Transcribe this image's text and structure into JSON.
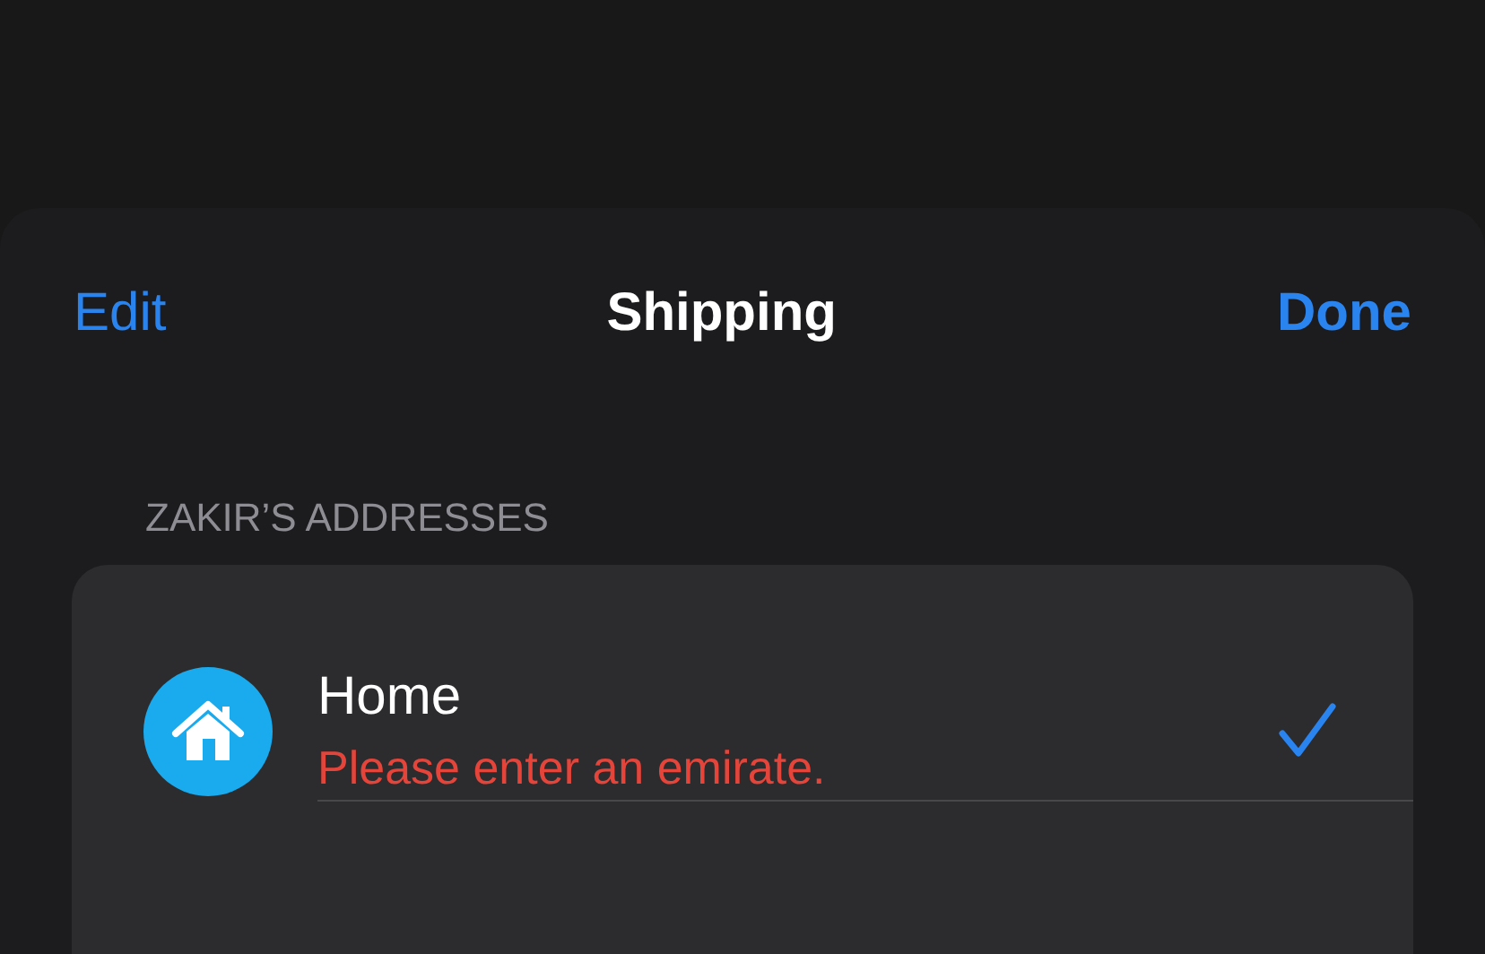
{
  "nav": {
    "left": "Edit",
    "title": "Shipping",
    "right": "Done"
  },
  "section": {
    "header": "ZAKIR’S ADDRESSES",
    "addresses": [
      {
        "label": "Home",
        "error": "Please enter an emirate.",
        "selected": true
      }
    ]
  }
}
